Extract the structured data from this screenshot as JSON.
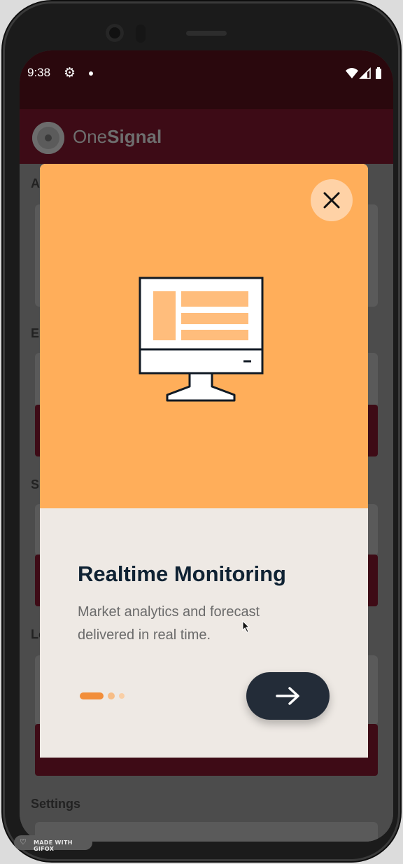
{
  "status_bar": {
    "time": "9:38",
    "icons": [
      "gear-icon",
      "notification-dot-icon",
      "wifi-icon",
      "signal-icon",
      "battery-icon"
    ]
  },
  "app_bar": {
    "logo_light": "One",
    "logo_bold": "Signal"
  },
  "background_sections": {
    "app": "Ap",
    "email": "Er",
    "sms": "Sl",
    "location": "Lo",
    "settings": "Settings"
  },
  "modal": {
    "title": "Realtime Monitoring",
    "description": "Market analytics and forecast delivered in real time.",
    "pager": {
      "total": 3,
      "active": 1
    },
    "colors": {
      "illustration_bg": "#ffae5a",
      "body_bg": "#eee9e4",
      "title": "#0f2233",
      "next_button": "#232c38",
      "pager_active": "#f28e3a"
    }
  },
  "watermark": {
    "text": "MADE WITH GIFOX"
  }
}
